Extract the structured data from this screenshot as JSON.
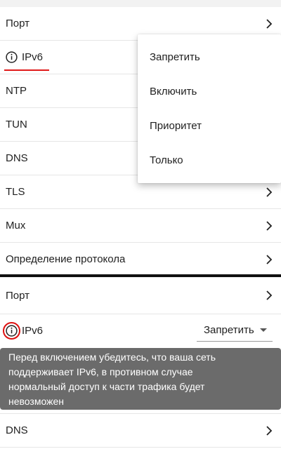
{
  "top_panel": {
    "rows": [
      {
        "label": "Порт",
        "has_chevron": true
      },
      {
        "label": "IPv6",
        "has_chevron": false,
        "icon": "info-icon"
      },
      {
        "label": "NTP",
        "has_chevron": false
      },
      {
        "label": "TUN",
        "has_chevron": false
      },
      {
        "label": "DNS",
        "has_chevron": false
      },
      {
        "label": "TLS",
        "has_chevron": true
      },
      {
        "label": "Mux",
        "has_chevron": true
      },
      {
        "label": "Определение протокола",
        "has_chevron": true
      }
    ],
    "popup_menu": {
      "items": [
        "Запретить",
        "Включить",
        "Приоритет",
        "Только"
      ]
    }
  },
  "bottom_panel": {
    "rows": [
      {
        "label": "Порт",
        "has_chevron": true
      },
      {
        "label": "IPv6",
        "icon": "info-icon"
      },
      {
        "label": "DNS",
        "has_chevron": true
      }
    ],
    "ipv6_select": {
      "selected": "Запретить"
    },
    "tooltip": {
      "lines": [
        "Перед включением убедитесь, что ваша сеть",
        "поддерживает IPv6, в противном случае",
        "нормальный доступ к части трафика будет",
        "невозможен"
      ]
    }
  },
  "colors": {
    "highlight": "#e01919",
    "tooltip_bg": "#6b6b6b",
    "divider": "#111111"
  }
}
